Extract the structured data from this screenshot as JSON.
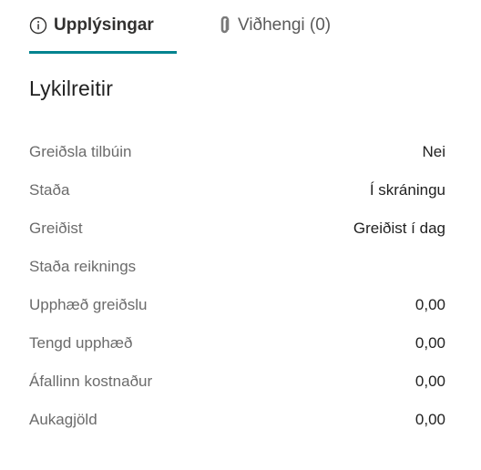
{
  "tabs": {
    "info": {
      "label": "Upplýsingar",
      "icon": "info-circle-icon"
    },
    "attachments": {
      "label": "Viðhengi (0)",
      "icon": "paperclip-icon"
    }
  },
  "section": {
    "title": "Lykilreitir"
  },
  "fields": [
    {
      "label": "Greiðsla tilbúin",
      "value": "Nei"
    },
    {
      "label": "Staða",
      "value": "Í skráningu"
    },
    {
      "label": "Greiðist",
      "value": "Greiðist í dag"
    },
    {
      "label": "Staða reiknings",
      "value": ""
    },
    {
      "label": "Upphæð greiðslu",
      "value": "0,00"
    },
    {
      "label": "Tengd upphæð",
      "value": "0,00"
    },
    {
      "label": "Áfallinn kostnaður",
      "value": "0,00"
    },
    {
      "label": "Aukagjöld",
      "value": "0,00"
    }
  ],
  "colors": {
    "accent": "#00838f"
  }
}
